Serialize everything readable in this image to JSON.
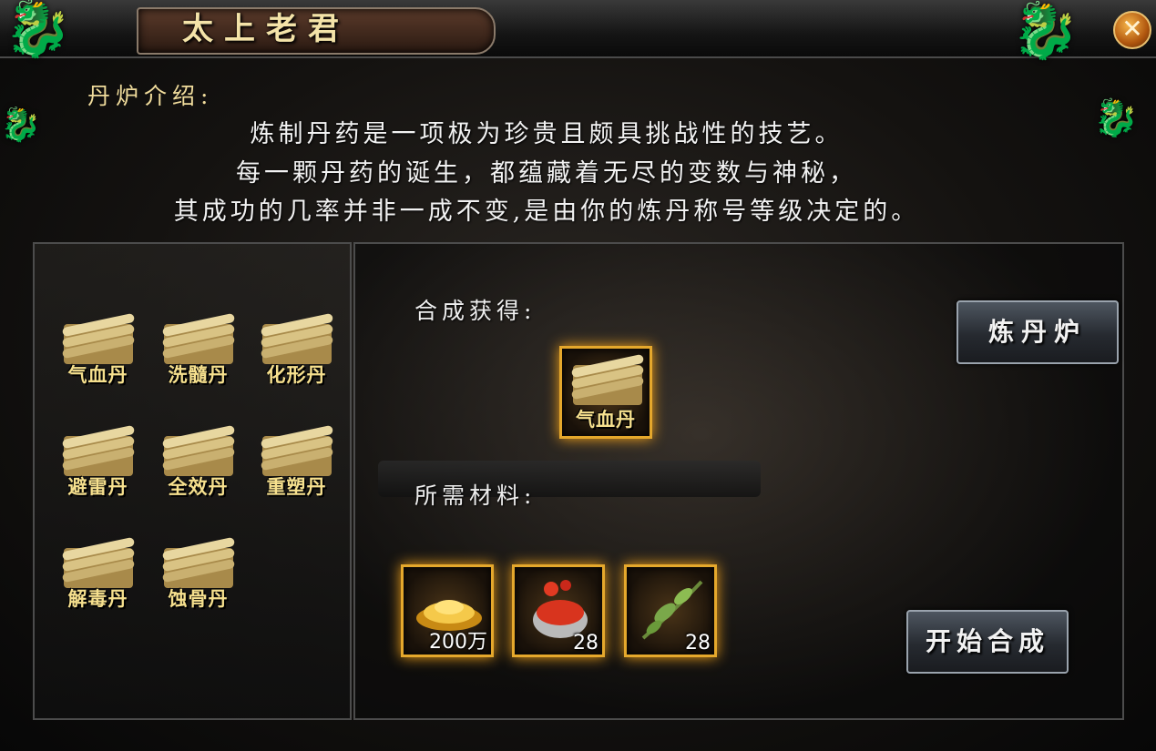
{
  "window": {
    "title": "太上老君",
    "close_icon": "close-x-icon"
  },
  "intro": {
    "heading": "丹炉介绍:",
    "lines": [
      "炼制丹药是一项极为珍贵且颇具挑战性的技艺。",
      "每一颗丹药的诞生，都蕴藏着无尽的变数与神秘，",
      "其成功的几率并非一成不变,是由你的炼丹称号等级决定的。"
    ]
  },
  "recipes": [
    {
      "label": "气血丹",
      "icon": "scroll-icon"
    },
    {
      "label": "洗髓丹",
      "icon": "scroll-icon"
    },
    {
      "label": "化形丹",
      "icon": "scroll-icon"
    },
    {
      "label": "避雷丹",
      "icon": "scroll-icon"
    },
    {
      "label": "全效丹",
      "icon": "scroll-icon"
    },
    {
      "label": "重塑丹",
      "icon": "scroll-icon"
    },
    {
      "label": "解毒丹",
      "icon": "scroll-icon"
    },
    {
      "label": "蚀骨丹",
      "icon": "scroll-icon"
    }
  ],
  "synthesis": {
    "result_label": "合成获得:",
    "result_item": {
      "label": "气血丹",
      "icon": "scroll-icon"
    },
    "materials_label": "所需材料:",
    "materials": [
      {
        "icon": "gold-ingot-icon",
        "count": "200万"
      },
      {
        "icon": "red-herb-pot-icon",
        "count": "28"
      },
      {
        "icon": "green-herb-icon",
        "count": "28"
      }
    ]
  },
  "buttons": {
    "furnace": "炼丹炉",
    "start": "开始合成"
  },
  "colors": {
    "accent_gold": "#e5a82c",
    "label_yellow": "#f6e08e",
    "close_orange": "#d9781a"
  }
}
